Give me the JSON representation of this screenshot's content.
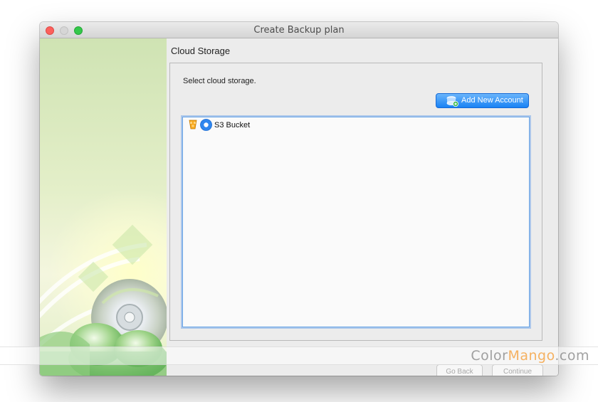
{
  "window": {
    "title": "Create Backup plan"
  },
  "titlebar": {
    "controls": [
      "close",
      "minimize",
      "zoom"
    ]
  },
  "content": {
    "section_title": "Cloud Storage",
    "instructions": "Select cloud storage.",
    "add_account_label": "Add New Account",
    "storage_list": [
      {
        "label": "S3 Bucket",
        "icons": [
          "amazon-s3-icon",
          "radio-selected-icon"
        ],
        "selected": true
      }
    ]
  },
  "footer": {
    "back_label": "Go Back",
    "continue_label": "Continue"
  },
  "watermark": {
    "part1": "Color",
    "part2": "Mango",
    "part3": ".com"
  },
  "colors": {
    "accent": "#1a82f4",
    "close": "#fc605c",
    "zoom": "#34c84a"
  }
}
